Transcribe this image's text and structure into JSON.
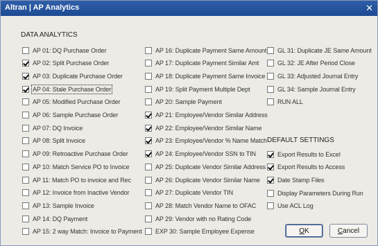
{
  "window": {
    "title": "Altran | AP Analytics",
    "close_glyph": "✕"
  },
  "data_analytics": {
    "heading": "DATA ANALYTICS",
    "col1": [
      {
        "label": "AP 01: DQ Purchase Order",
        "checked": false
      },
      {
        "label": "AP 02: Split Purchase Order",
        "checked": true
      },
      {
        "label": "AP 03: Duplicate Purchase Order",
        "checked": true
      },
      {
        "label": "AP 04: Stale Purchase Order",
        "checked": true,
        "focused": true
      },
      {
        "label": "AP 05: Modified Purchase Order",
        "checked": false
      },
      {
        "label": "AP 06: Sample Purchase Order",
        "checked": false
      },
      {
        "label": "AP 07: DQ Invoice",
        "checked": false
      },
      {
        "label": "AP 08: Split Invoice",
        "checked": false
      },
      {
        "label": "AP 09: Retroactive Purchase Order",
        "checked": false
      },
      {
        "label": "AP 10: Match Service PO to Invoice",
        "checked": false
      },
      {
        "label": "AP 11: Match PO to invoice and Rec",
        "checked": false
      },
      {
        "label": "AP 12: Invoice from Inactive Vendor",
        "checked": false
      },
      {
        "label": "AP 13: Sample Invoice",
        "checked": false
      },
      {
        "label": "AP 14: DQ Payment",
        "checked": false
      },
      {
        "label": "AP 15: 2 way Match: Invoice to Payment",
        "checked": false
      }
    ],
    "col2": [
      {
        "label": "AP 16: Duplicate Payment Same Amount",
        "checked": false
      },
      {
        "label": "AP 17: Duplicate Payment Similar Amt",
        "checked": false
      },
      {
        "label": "AP 18: Duplicate Payment Same Invoice",
        "checked": false
      },
      {
        "label": "AP 19: Split Payment Multiple Dept",
        "checked": false
      },
      {
        "label": "AP 20: Sample Payment",
        "checked": false
      },
      {
        "label": "AP 21: Employee/Vendor Similar Address",
        "checked": true
      },
      {
        "label": "AP 22: Employee/Vendor Similar Name",
        "checked": true
      },
      {
        "label": "AP 23: Employee/Vendor % Name Match",
        "checked": true
      },
      {
        "label": "AP 24: Employee/Vendor SSN to TIN",
        "checked": true
      },
      {
        "label": "AP 25: Duplicate Vendor Similar Address",
        "checked": false
      },
      {
        "label": "AP 26: Duplicate Vendor Similar Name",
        "checked": false
      },
      {
        "label": "AP 27: Duplicate Vendor TIN",
        "checked": false
      },
      {
        "label": "AP 28: Match Vendor Name to OFAC",
        "checked": false
      },
      {
        "label": "AP 29: Vendor with no Rating Code",
        "checked": false
      },
      {
        "label": "EXP 30: Sample Employee Expense",
        "checked": false
      }
    ],
    "col3": [
      {
        "label": "GL 31: Duplicate JE Same Amount",
        "checked": false
      },
      {
        "label": "GL 32: JE After Period Close",
        "checked": false
      },
      {
        "label": "GL 33: Adjusted Journal Entry",
        "checked": false
      },
      {
        "label": "GL 34: Sample Journal Entry",
        "checked": false
      },
      {
        "label": "RUN ALL",
        "checked": false
      }
    ]
  },
  "default_settings": {
    "heading": "DEFAULT SETTINGS",
    "items": [
      {
        "label": "Export Results to Excel",
        "checked": true
      },
      {
        "label": "Export Results to Access",
        "checked": true
      },
      {
        "label": "Date Stamp Files",
        "checked": true
      },
      {
        "label": "Display Parameters During Run",
        "checked": false
      },
      {
        "label": "Use ACL Log",
        "checked": false
      }
    ]
  },
  "buttons": {
    "ok_mnemonic": "O",
    "ok_rest": "K",
    "cancel_mnemonic": "C",
    "cancel_rest": "ancel"
  }
}
